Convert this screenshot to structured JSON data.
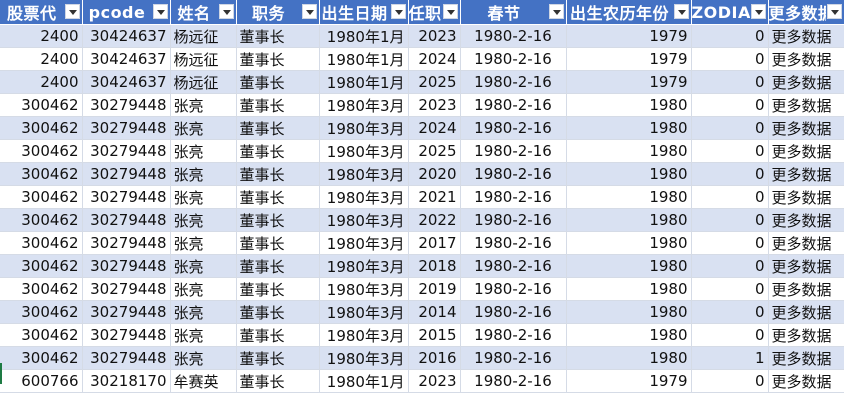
{
  "headers": [
    "股票代",
    "pcode",
    "姓名",
    "职务",
    "出生日期",
    "任职年",
    "春节",
    "出生农历年份",
    "ZODIAC",
    "更多数据"
  ],
  "rows": [
    [
      "2400",
      "30424637",
      "杨远征",
      "董事长",
      "1980年1月",
      "2023",
      "1980-2-16",
      "1979",
      "0",
      "更多数据"
    ],
    [
      "2400",
      "30424637",
      "杨远征",
      "董事长",
      "1980年1月",
      "2024",
      "1980-2-16",
      "1979",
      "0",
      "更多数据"
    ],
    [
      "2400",
      "30424637",
      "杨远征",
      "董事长",
      "1980年1月",
      "2025",
      "1980-2-16",
      "1979",
      "0",
      "更多数据"
    ],
    [
      "300462",
      "30279448",
      "张亮",
      "董事长",
      "1980年3月",
      "2023",
      "1980-2-16",
      "1980",
      "0",
      "更多数据"
    ],
    [
      "300462",
      "30279448",
      "张亮",
      "董事长",
      "1980年3月",
      "2024",
      "1980-2-16",
      "1980",
      "0",
      "更多数据"
    ],
    [
      "300462",
      "30279448",
      "张亮",
      "董事长",
      "1980年3月",
      "2025",
      "1980-2-16",
      "1980",
      "0",
      "更多数据"
    ],
    [
      "300462",
      "30279448",
      "张亮",
      "董事长",
      "1980年3月",
      "2020",
      "1980-2-16",
      "1980",
      "0",
      "更多数据"
    ],
    [
      "300462",
      "30279448",
      "张亮",
      "董事长",
      "1980年3月",
      "2021",
      "1980-2-16",
      "1980",
      "0",
      "更多数据"
    ],
    [
      "300462",
      "30279448",
      "张亮",
      "董事长",
      "1980年3月",
      "2022",
      "1980-2-16",
      "1980",
      "0",
      "更多数据"
    ],
    [
      "300462",
      "30279448",
      "张亮",
      "董事长",
      "1980年3月",
      "2017",
      "1980-2-16",
      "1980",
      "0",
      "更多数据"
    ],
    [
      "300462",
      "30279448",
      "张亮",
      "董事长",
      "1980年3月",
      "2018",
      "1980-2-16",
      "1980",
      "0",
      "更多数据"
    ],
    [
      "300462",
      "30279448",
      "张亮",
      "董事长",
      "1980年3月",
      "2019",
      "1980-2-16",
      "1980",
      "0",
      "更多数据"
    ],
    [
      "300462",
      "30279448",
      "张亮",
      "董事长",
      "1980年3月",
      "2014",
      "1980-2-16",
      "1980",
      "0",
      "更多数据"
    ],
    [
      "300462",
      "30279448",
      "张亮",
      "董事长",
      "1980年3月",
      "2015",
      "1980-2-16",
      "1980",
      "0",
      "更多数据"
    ],
    [
      "300462",
      "30279448",
      "张亮",
      "董事长",
      "1980年3月",
      "2016",
      "1980-2-16",
      "1980",
      "1",
      "更多数据"
    ],
    [
      "600766",
      "30218170",
      "牟赛英",
      "董事长",
      "1980年1月",
      "2023",
      "1980-2-16",
      "1979",
      "0",
      "更多数据"
    ]
  ],
  "colors": {
    "header_bg": "#4472c4",
    "band": "#d9e1f2",
    "marker": "#1e7b44"
  }
}
